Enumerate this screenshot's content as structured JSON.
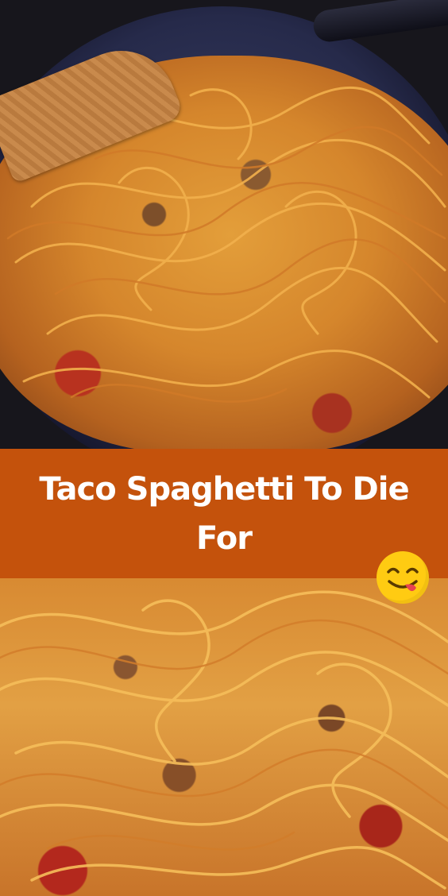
{
  "banner": {
    "title": "Taco Spaghetti To Die For"
  },
  "images": {
    "top": "taco-spaghetti-photo",
    "bottom": "taco-spaghetti-closeup-photo"
  },
  "emoji": "face-savoring-food-icon",
  "colors": {
    "banner_bg": "#c4520c",
    "banner_text": "#ffffff",
    "emoji_yellow": "#ffcb12"
  }
}
